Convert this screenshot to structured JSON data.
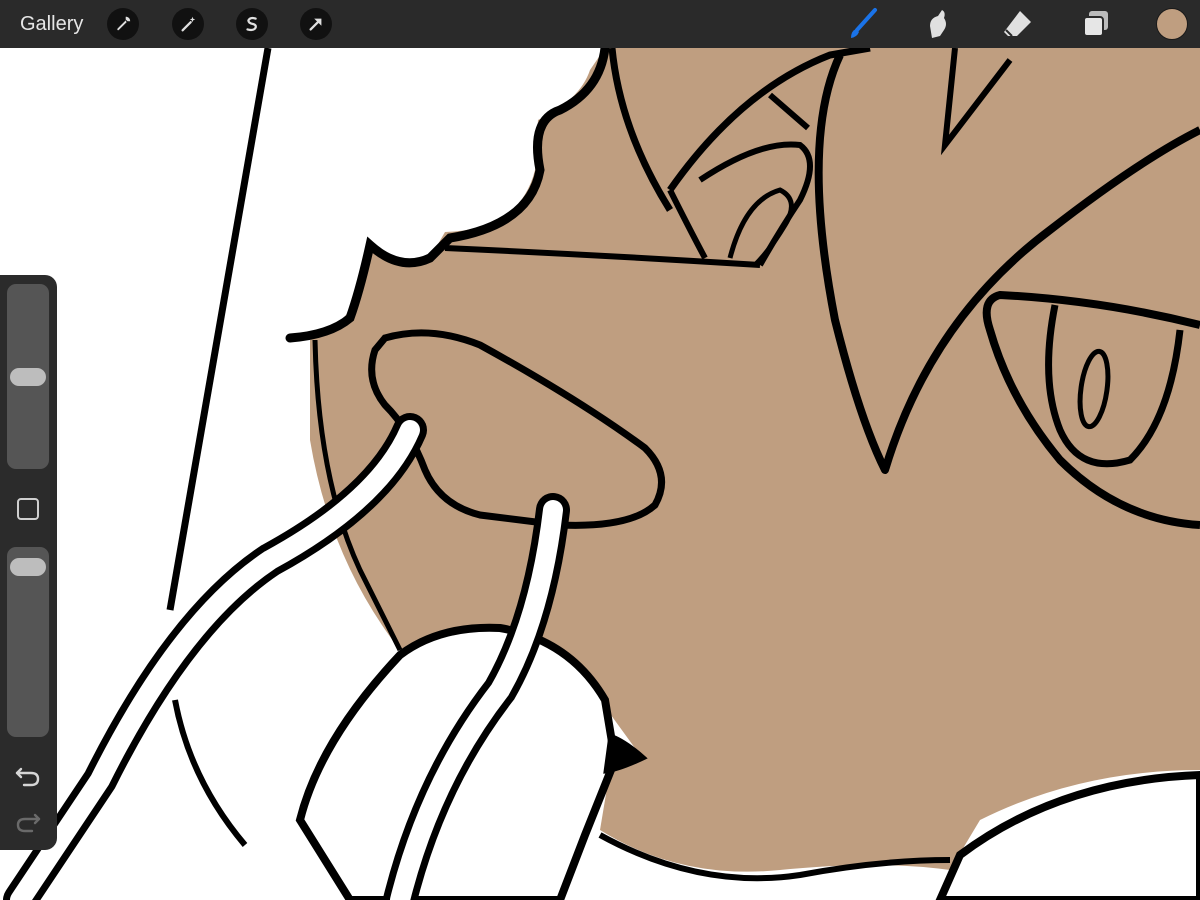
{
  "toolbar": {
    "gallery_label": "Gallery",
    "left_tools": [
      {
        "name": "wrench-icon"
      },
      {
        "name": "magic-wand-icon"
      },
      {
        "name": "selection-icon"
      },
      {
        "name": "transform-arrow-icon"
      }
    ],
    "right_tools": [
      {
        "name": "brush-icon",
        "active": true
      },
      {
        "name": "smudge-icon"
      },
      {
        "name": "eraser-icon"
      },
      {
        "name": "layers-icon"
      }
    ],
    "active_tool_color": "#1a73e8",
    "current_color": "#bf9e80"
  },
  "sidebar": {
    "brush_size_level": 0.5,
    "opacity_level": 0.95,
    "icons": [
      "square-modify-icon",
      "undo-icon",
      "redo-icon"
    ]
  },
  "canvas": {
    "skin_color": "#bf9e80",
    "line_color": "#000000",
    "background_color": "#ffffff"
  }
}
